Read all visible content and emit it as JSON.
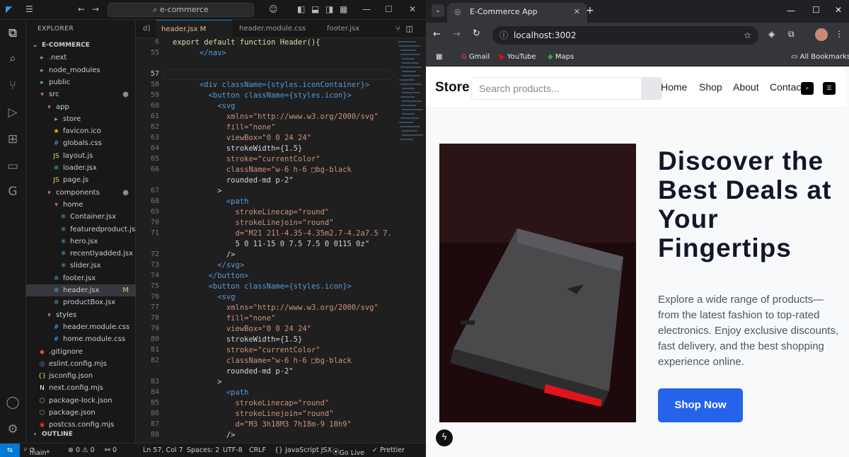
{
  "vscode": {
    "search_text": "e-commerce",
    "explorer_header": "EXPLORER",
    "tree": [
      {
        "label": "E-COMMERCE",
        "icon": "chevron-down-icon",
        "depth": 0,
        "badge": ""
      },
      {
        "label": ".next",
        "icon": "folder-icon",
        "depth": 1,
        "badge": ""
      },
      {
        "label": "node_modules",
        "icon": "folder-icon",
        "depth": 1,
        "badge": ""
      },
      {
        "label": "public",
        "icon": "folder-icon",
        "depth": 1,
        "badge": ""
      },
      {
        "label": "src",
        "icon": "folder-open-icon",
        "depth": 1,
        "badge": "●"
      },
      {
        "label": "app",
        "icon": "folder-open-icon",
        "depth": 2,
        "badge": ""
      },
      {
        "label": "store",
        "icon": "folder-icon",
        "depth": 3,
        "badge": ""
      },
      {
        "label": "favicon.ico",
        "icon": "star-icon",
        "depth": 3,
        "badge": ""
      },
      {
        "label": "globals.css",
        "icon": "css-icon",
        "depth": 3,
        "badge": ""
      },
      {
        "label": "layout.js",
        "icon": "js-icon",
        "depth": 3,
        "badge": ""
      },
      {
        "label": "loader.jsx",
        "icon": "react-icon",
        "depth": 3,
        "badge": ""
      },
      {
        "label": "page.js",
        "icon": "js-icon",
        "depth": 3,
        "badge": ""
      },
      {
        "label": "components",
        "icon": "folder-open-icon",
        "depth": 2,
        "badge": "●"
      },
      {
        "label": "home",
        "icon": "folder-open-icon",
        "depth": 3,
        "badge": ""
      },
      {
        "label": "Container.jsx",
        "icon": "react-icon",
        "depth": 4,
        "badge": ""
      },
      {
        "label": "featuredproduct.jsx",
        "icon": "react-icon",
        "depth": 4,
        "badge": ""
      },
      {
        "label": "hero.jsx",
        "icon": "react-icon",
        "depth": 4,
        "badge": ""
      },
      {
        "label": "recentlyadded.jsx",
        "icon": "react-icon",
        "depth": 4,
        "badge": ""
      },
      {
        "label": "slider.jsx",
        "icon": "react-icon",
        "depth": 4,
        "badge": ""
      },
      {
        "label": "footer.jsx",
        "icon": "react-icon",
        "depth": 3,
        "badge": ""
      },
      {
        "label": "header.jsx",
        "icon": "react-icon",
        "depth": 3,
        "badge": "M"
      },
      {
        "label": "productBox.jsx",
        "icon": "react-icon",
        "depth": 3,
        "badge": ""
      },
      {
        "label": "styles",
        "icon": "folder-open-icon",
        "depth": 2,
        "badge": ""
      },
      {
        "label": "header.module.css",
        "icon": "css-icon",
        "depth": 3,
        "badge": ""
      },
      {
        "label": "home.module.css",
        "icon": "css-icon",
        "depth": 3,
        "badge": ""
      },
      {
        "label": ".gitignore",
        "icon": "git-icon",
        "depth": 1,
        "badge": ""
      },
      {
        "label": "eslint.config.mjs",
        "icon": "eslint-icon",
        "depth": 1,
        "badge": ""
      },
      {
        "label": "jsconfig.json",
        "icon": "json-icon",
        "depth": 1,
        "badge": ""
      },
      {
        "label": "next.config.mjs",
        "icon": "next-icon",
        "depth": 1,
        "badge": ""
      },
      {
        "label": "package-lock.json",
        "icon": "npm-icon",
        "depth": 1,
        "badge": ""
      },
      {
        "label": "package.json",
        "icon": "npm-icon",
        "depth": 1,
        "badge": ""
      },
      {
        "label": "postcss.config.mjs",
        "icon": "postcss-icon",
        "depth": 1,
        "badge": ""
      },
      {
        "label": "OUTLINE",
        "icon": "chevron-right-icon",
        "depth": 0,
        "badge": ""
      }
    ],
    "tabs": [
      {
        "label": "d]",
        "active": false
      },
      {
        "label": "header.jsx M",
        "active": true
      },
      {
        "label": "header.module.css",
        "active": false
      },
      {
        "label": "footer.jsx",
        "active": false
      }
    ],
    "gutter": [
      "6",
      "55",
      "",
      "57",
      "58",
      "59",
      "60",
      "61",
      "62",
      "63",
      "64",
      "65",
      "66",
      "",
      "67",
      "68",
      "69",
      "70",
      "71",
      "",
      "72",
      "73",
      "74",
      "75",
      "76",
      "77",
      "78",
      "79",
      "80",
      "81",
      "82",
      "",
      "83",
      "84",
      "85",
      "86",
      "87",
      "88"
    ],
    "code": [
      "export default function Header(){",
      "      </nav>",
      "",
      "",
      "      <div className={styles.iconContainer}>",
      "        <button className={styles.icon}>",
      "          <svg",
      "            xmlns=\"http://www.w3.org/2000/svg\"",
      "            fill=\"none\"",
      "            viewBox=\"0 0 24 24\"",
      "            strokeWidth={1.5}",
      "            stroke=\"currentColor\"",
      "            className=\"w-6 h-6 □bg-black",
      "            rounded-md p-2\"",
      "          >",
      "            <path",
      "              strokeLinecap=\"round\"",
      "              strokeLinejoin=\"round\"",
      "              d=\"M21 21l-4.35-4.35m2.7-4.2a7.5 7.",
      "              5 0 11-15 0 7.5 7.5 0 0115 0z\"",
      "            />",
      "          </svg>",
      "        </button>",
      "        <button className={styles.icon}>",
      "          <svg",
      "            xmlns=\"http://www.w3.org/2000/svg\"",
      "            fill=\"none\"",
      "            viewBox=\"0 0 24 24\"",
      "            strokeWidth={1.5}",
      "            stroke=\"currentColor\"",
      "            className=\"w-6 h-6 □bg-black",
      "            rounded-md p-2\"",
      "          >",
      "            <path",
      "              strokeLinecap=\"round\"",
      "              strokeLinejoin=\"round\"",
      "              d=\"M3 3h18M3 7h18m-9 10h9\"",
      "            />"
    ],
    "status": {
      "branch": "main*",
      "problems": "⊗ 0 ⚠ 0",
      "ports": "⚯ 0",
      "position": "Ln 57, Col 7",
      "spaces": "Spaces: 2",
      "encoding": "UTF-8",
      "eol": "CRLF",
      "language": "{} JavaScript JSX",
      "golive": "Go Live",
      "prettier": "✓ Prettier"
    }
  },
  "browser": {
    "tab_title": "E-Commerce App",
    "url": "localhost:3002",
    "bookmarks": [
      "Gmail",
      "YouTube",
      "Maps"
    ],
    "all_bookmarks": "All Bookmarks",
    "site": {
      "brand": "Store",
      "search_placeholder": "Search products...",
      "nav": [
        "Home",
        "Shop",
        "About",
        "Contact"
      ],
      "heading": "Discover the Best Deals at Your Fingertips",
      "description": "Explore a wide range of products—from the latest fashion to top-rated electronics. Enjoy exclusive discounts, fast delivery, and the best shopping experience online.",
      "cta": "Shop Now"
    }
  },
  "colors": {
    "accent": "#0078d4",
    "cta": "#2563eb",
    "heading": "#0f172a"
  }
}
